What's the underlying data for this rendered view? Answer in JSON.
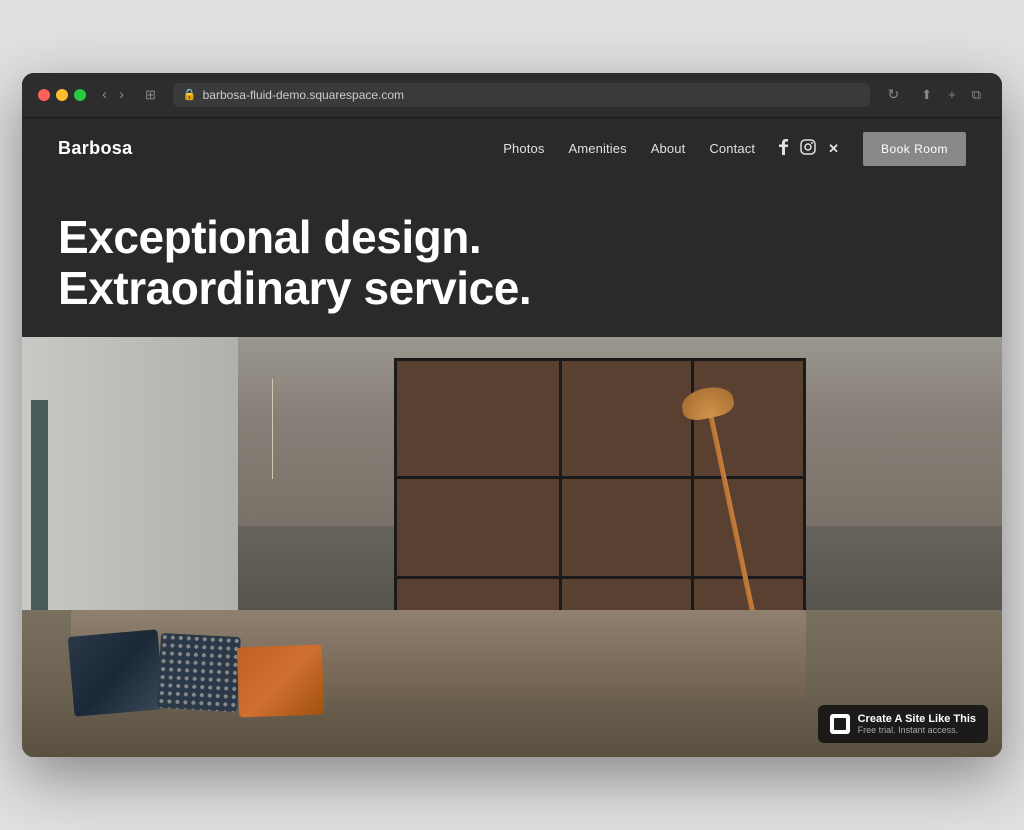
{
  "browser": {
    "url": "barbosa-fluid-demo.squarespace.com",
    "back_btn": "‹",
    "forward_btn": "›",
    "reload_icon": "↻"
  },
  "site": {
    "logo": "Barbosa",
    "nav": {
      "links": [
        {
          "label": "Photos"
        },
        {
          "label": "Amenities"
        },
        {
          "label": "About"
        },
        {
          "label": "Contact"
        }
      ],
      "book_btn": "Book Room"
    },
    "hero": {
      "headline_line1": "Exceptional design.",
      "headline_line2": "Extraordinary service."
    }
  },
  "squarespace_badge": {
    "title": "Create A Site Like This",
    "subtitle": "Free trial. Instant access."
  }
}
